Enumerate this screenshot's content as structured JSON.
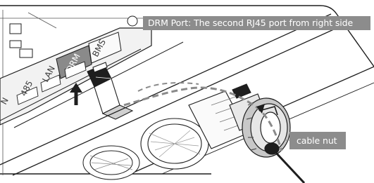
{
  "callouts": {
    "drm_port": "DRM Port: The second RJ45 port from right side",
    "cable_nut": "cable nut"
  },
  "ports": {
    "n": "N",
    "p485": "485",
    "lan": "LAN",
    "drm": "DRM",
    "bms": "BMS"
  },
  "colors": {
    "line": "#1e1e1e",
    "drm_highlight": "#8a8a8a",
    "cable_dash": "#8a8a8a",
    "callout_bg": "#8c8c8c",
    "callout_text": "#ffffff"
  }
}
